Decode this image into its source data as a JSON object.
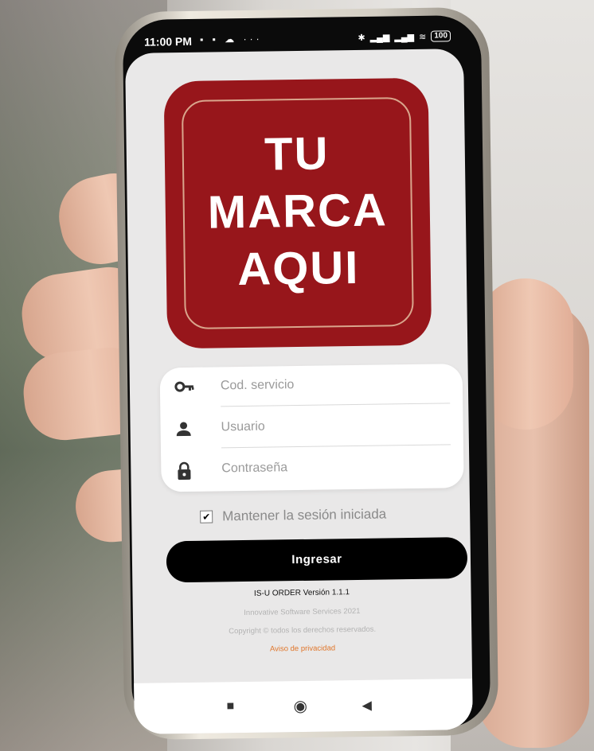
{
  "status_bar": {
    "time": "11:00 PM",
    "left_icons": "▪ ▪ ☁ ···",
    "battery": "100"
  },
  "logo": {
    "lines": [
      "TU",
      "MARCA",
      "AQUI"
    ],
    "color": "#97161b"
  },
  "login": {
    "service_placeholder": "Cod. servicio",
    "user_placeholder": "Usuario",
    "password_placeholder": "Contraseña"
  },
  "remember": {
    "label": "Mantener la sesión iniciada",
    "checked": true
  },
  "submit": {
    "label": "Ingresar"
  },
  "footer": {
    "version": "IS-U ORDER Versión 1.1.1",
    "company": "Innovative Software Services 2021",
    "copyright": "Copyright © todos los derechos reservados.",
    "privacy": "Aviso de privacidad",
    "privacy_color": "#e0762b"
  },
  "nav": {
    "recent": "■",
    "home": "◉",
    "back": "◀"
  }
}
